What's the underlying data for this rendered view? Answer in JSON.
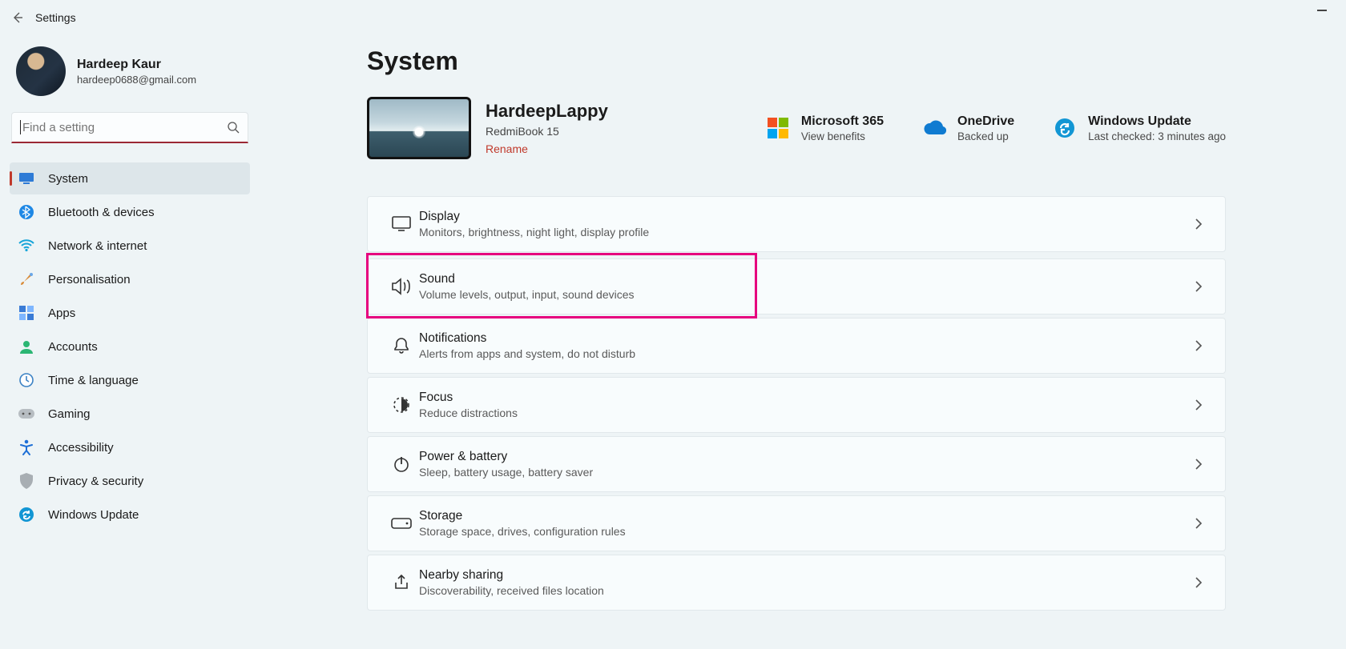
{
  "window": {
    "title": "Settings"
  },
  "profile": {
    "name": "Hardeep Kaur",
    "email": "hardeep0688@gmail.com"
  },
  "search": {
    "placeholder": "Find a setting"
  },
  "nav": [
    {
      "label": "System"
    },
    {
      "label": "Bluetooth & devices"
    },
    {
      "label": "Network & internet"
    },
    {
      "label": "Personalisation"
    },
    {
      "label": "Apps"
    },
    {
      "label": "Accounts"
    },
    {
      "label": "Time & language"
    },
    {
      "label": "Gaming"
    },
    {
      "label": "Accessibility"
    },
    {
      "label": "Privacy & security"
    },
    {
      "label": "Windows Update"
    }
  ],
  "page": {
    "title": "System",
    "device": {
      "name": "HardeepLappy",
      "model": "RedmiBook 15",
      "rename": "Rename"
    },
    "quick": {
      "m365": {
        "title": "Microsoft 365",
        "sub": "View benefits"
      },
      "onedrive": {
        "title": "OneDrive",
        "sub": "Backed up"
      },
      "wu": {
        "title": "Windows Update",
        "sub": "Last checked: 3 minutes ago"
      }
    },
    "cards": [
      {
        "title": "Display",
        "sub": "Monitors, brightness, night light, display profile"
      },
      {
        "title": "Sound",
        "sub": "Volume levels, output, input, sound devices"
      },
      {
        "title": "Notifications",
        "sub": "Alerts from apps and system, do not disturb"
      },
      {
        "title": "Focus",
        "sub": "Reduce distractions"
      },
      {
        "title": "Power & battery",
        "sub": "Sleep, battery usage, battery saver"
      },
      {
        "title": "Storage",
        "sub": "Storage space, drives, configuration rules"
      },
      {
        "title": "Nearby sharing",
        "sub": "Discoverability, received files location"
      }
    ]
  }
}
